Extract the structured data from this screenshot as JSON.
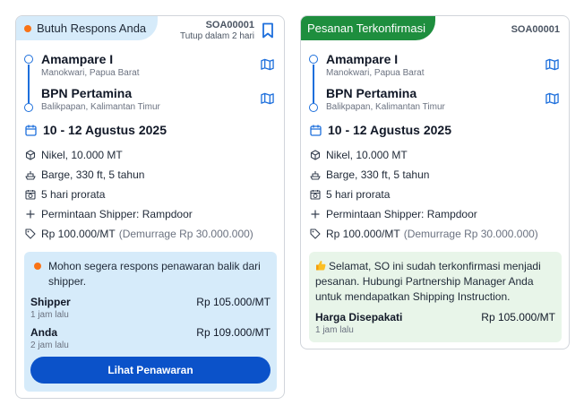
{
  "cards": [
    {
      "status_tag": "Butuh Respons Anda",
      "code": "SOA00001",
      "closing": "Tutup dalam 2 hari",
      "origin": {
        "name": "Amampare I",
        "region": "Manokwari, Papua Barat"
      },
      "destination": {
        "name": "BPN Pertamina",
        "region": "Balikpapan, Kalimantan Timur"
      },
      "date": "10 - 12 Agustus 2025",
      "cargo": "Nikel, 10.000 MT",
      "vessel": "Barge, 330 ft, 5 tahun",
      "laytime": "5 hari prorata",
      "request": "Permintaan Shipper: Rampdoor",
      "price": "Rp 100.000/MT",
      "demurrage": "(Demurrage Rp 30.000.000)",
      "panel": {
        "message": "Mohon segera respons penawaran balik dari shipper.",
        "offers": [
          {
            "name": "Shipper",
            "price": "Rp 105.000/MT",
            "time": "1 jam lalu"
          },
          {
            "name": "Anda",
            "price": "Rp 109.000/MT",
            "time": "2 jam lalu"
          }
        ],
        "button": "Lihat Penawaran"
      }
    },
    {
      "status_tag": "Pesanan Terkonfirmasi",
      "code": "SOA00001",
      "origin": {
        "name": "Amampare I",
        "region": "Manokwari, Papua Barat"
      },
      "destination": {
        "name": "BPN Pertamina",
        "region": "Balikpapan, Kalimantan Timur"
      },
      "date": "10 - 12 Agustus 2025",
      "cargo": "Nikel, 10.000 MT",
      "vessel": "Barge, 330 ft, 5 tahun",
      "laytime": "5 hari prorata",
      "request": "Permintaan Shipper: Rampdoor",
      "price": "Rp 100.000/MT",
      "demurrage": "(Demurrage Rp 30.000.000)",
      "panel": {
        "message": "Selamat, SO ini sudah terkonfirmasi menjadi pesanan. Hubungi Partnership Manager Anda untuk mendapatkan Shipping Instruction.",
        "agreed_label": "Harga Disepakati",
        "agreed_price": "Rp 105.000/MT",
        "time": "1 jam lalu"
      }
    }
  ],
  "colors": {
    "accent_blue": "#1d6fdc",
    "button_blue": "#0b52c9",
    "confirmed_green": "#1e8e3e",
    "pending_bg": "#d6ebfa",
    "alert_orange": "#f97316"
  }
}
